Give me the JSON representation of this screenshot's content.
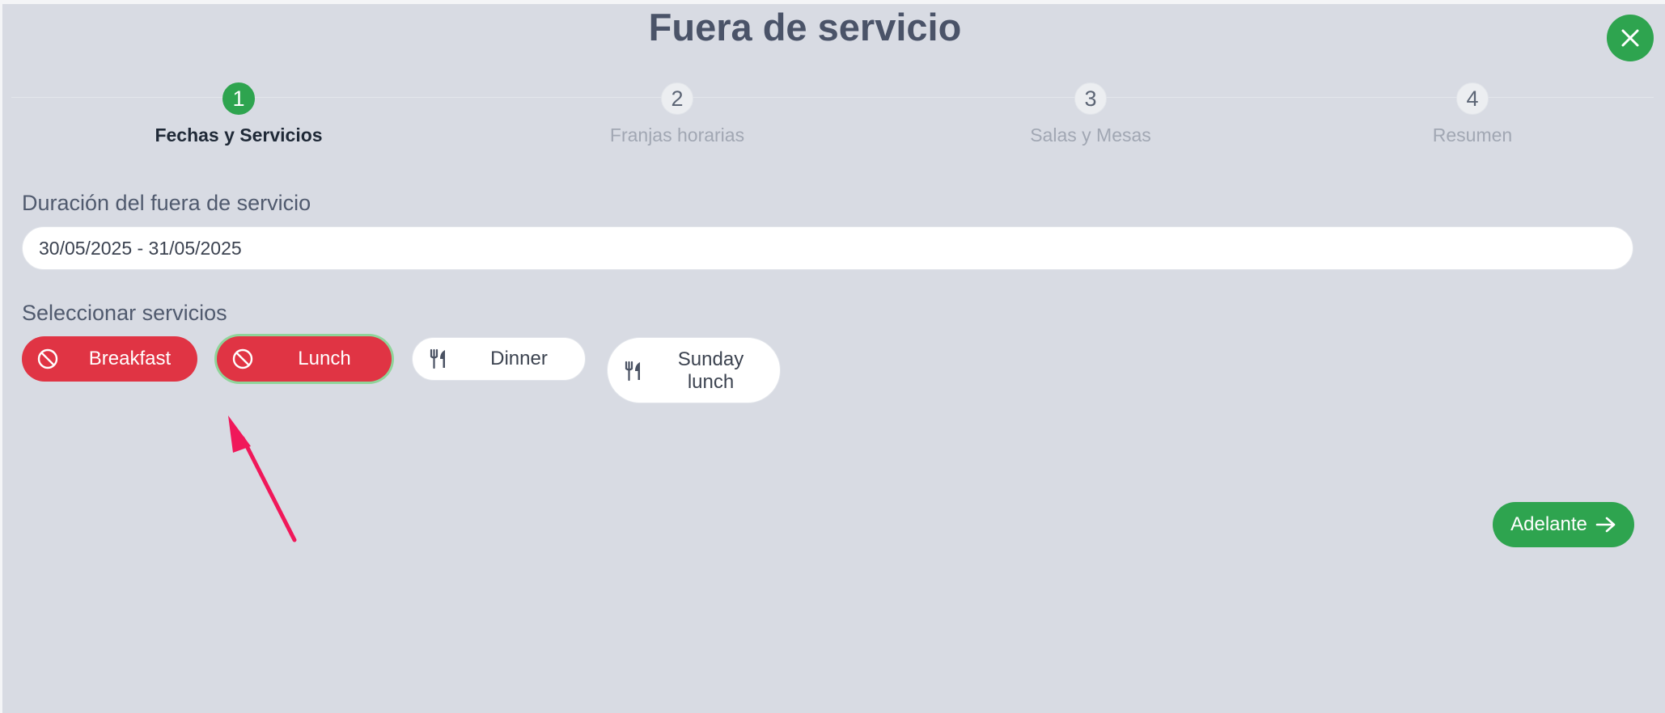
{
  "modal": {
    "title": "Fuera de servicio"
  },
  "steps": [
    {
      "number": "1",
      "label": "Fechas y Servicios",
      "active": true
    },
    {
      "number": "2",
      "label": "Franjas horarias",
      "active": false
    },
    {
      "number": "3",
      "label": "Salas y Mesas",
      "active": false
    },
    {
      "number": "4",
      "label": "Resumen",
      "active": false
    }
  ],
  "duration": {
    "label": "Duración del fuera de servicio",
    "value": "30/05/2025 - 31/05/2025"
  },
  "services": {
    "label": "Seleccionar servicios",
    "items": [
      {
        "label": "Breakfast",
        "state": "disabled",
        "icon": "ban-icon"
      },
      {
        "label": "Lunch",
        "state": "disabled",
        "icon": "ban-icon",
        "focused": true
      },
      {
        "label": "Dinner",
        "state": "enabled",
        "icon": "utensils-icon"
      },
      {
        "label": "Sunday lunch",
        "state": "enabled",
        "icon": "utensils-icon"
      }
    ]
  },
  "actions": {
    "next_label": "Adelante"
  },
  "colors": {
    "accent_green": "#2ea44f",
    "disabled_red": "#e03444",
    "annotation_arrow": "#f0185a",
    "background": "#d8dbe3"
  }
}
